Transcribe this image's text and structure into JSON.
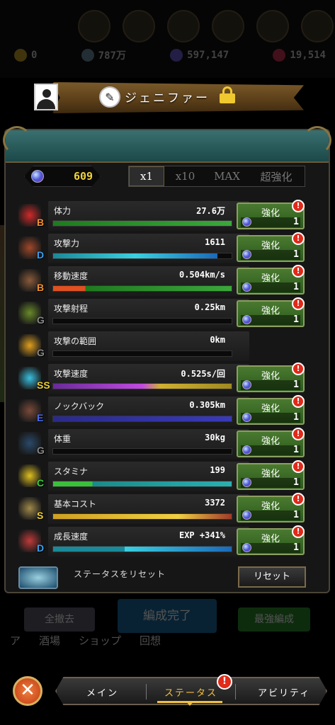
{
  "resources": {
    "r1": "0",
    "r2": "787万",
    "r3": "597,147",
    "r4": "19,514"
  },
  "character": {
    "name": "ジェニファー"
  },
  "gems": "609",
  "multiplier_tabs": [
    "x1",
    "x10",
    "MAX",
    "超強化"
  ],
  "stats": [
    {
      "name": "体力",
      "value": "27.6万",
      "grade": "B",
      "grade_color": "#f09030",
      "icon": "heart-icon",
      "icon_color": "#d02a2a",
      "fill": 1.0,
      "bar": "linear-gradient(90deg,#1e7a1e,#3aa83a)",
      "upgradable": true
    },
    {
      "name": "攻撃力",
      "value": "1611",
      "grade": "D",
      "grade_color": "#3aa0f0",
      "icon": "sword-icon",
      "icon_color": "#a0482a",
      "fill": 0.92,
      "bar": "linear-gradient(90deg,#1a8a9a,#3ad0e0,#1a6aba)",
      "upgradable": true
    },
    {
      "name": "移動速度",
      "value": "0.504km/s",
      "grade": "B",
      "grade_color": "#f09030",
      "icon": "boot-icon",
      "icon_color": "#8a5a3a",
      "fill": 1.0,
      "bar": "linear-gradient(90deg,#e05020 0 18%,#1e7a1e 18%,#3aa83a)",
      "upgradable": true
    },
    {
      "name": "攻撃射程",
      "value": "0.25km",
      "grade": "G",
      "grade_color": "#888888",
      "icon": "bow-icon",
      "icon_color": "#6a8a2a",
      "fill": 0.0,
      "bar": "#333",
      "upgradable": true
    },
    {
      "name": "攻撃の範囲",
      "value": "0km",
      "grade": "G",
      "grade_color": "#888888",
      "icon": "lightning-icon",
      "icon_color": "#e0a020",
      "fill": 0.0,
      "bar": "#333",
      "upgradable": false
    },
    {
      "name": "攻撃速度",
      "value": "0.525s/回",
      "grade": "SS",
      "grade_color": "#f0d030",
      "icon": "speed-icon",
      "icon_color": "#3ac0e0",
      "fill": 1.0,
      "bar": "linear-gradient(90deg,#6a2a9a,#c04ae0 50%,#d0b030 60%,#a08a20)",
      "upgradable": true
    },
    {
      "name": "ノックバック",
      "value": "0.305km",
      "grade": "E",
      "grade_color": "#4a6af0",
      "icon": "knockback-icon",
      "icon_color": "#7a4a3a",
      "fill": 1.0,
      "bar": "linear-gradient(90deg,#2a2a8a,#3a3aba)",
      "upgradable": true
    },
    {
      "name": "体重",
      "value": "30kg",
      "grade": "G",
      "grade_color": "#888888",
      "icon": "weight-icon",
      "icon_color": "#2a4a6a",
      "fill": 0.0,
      "bar": "#333",
      "upgradable": true
    },
    {
      "name": "スタミナ",
      "value": "199",
      "grade": "C",
      "grade_color": "#3ad03a",
      "icon": "stamina-heart-icon",
      "icon_color": "#e0c020",
      "fill": 1.0,
      "bar": "linear-gradient(90deg,#3ac03a 0 22%,#1a8a8a 22%,#2ab0b0)",
      "upgradable": true
    },
    {
      "name": "基本コスト",
      "value": "3372",
      "grade": "S",
      "grade_color": "#f0d030",
      "icon": "cost-icon",
      "icon_color": "#a08a4a",
      "fill": 1.0,
      "bar": "linear-gradient(90deg,#d0a020,#f0d040 70%,#a03a2a)",
      "upgradable": true
    },
    {
      "name": "成長速度",
      "value": "EXP +341%",
      "grade": "D",
      "grade_color": "#3aa0f0",
      "icon": "growth-chart-icon",
      "icon_color": "#c03a3a",
      "fill": 1.0,
      "bar": "linear-gradient(90deg,#1a8a9a 0 40%,#3ad0e0 40%,#1a6aba)",
      "upgradable": true
    }
  ],
  "upgrade": {
    "label": "強化",
    "count": "1",
    "alert": "!"
  },
  "reset": {
    "title": "ステータスをリセット",
    "button": "リセット"
  },
  "background_controls": {
    "left_btn": "全撤去",
    "center_btn": "編成完了",
    "right_btn": "最強編成",
    "tabs": [
      "ア",
      "酒場",
      "ショップ",
      "回想"
    ]
  },
  "nav": {
    "items": [
      "メイン",
      "ステータス",
      "アビリティ"
    ],
    "active": 1,
    "alert": "!"
  }
}
